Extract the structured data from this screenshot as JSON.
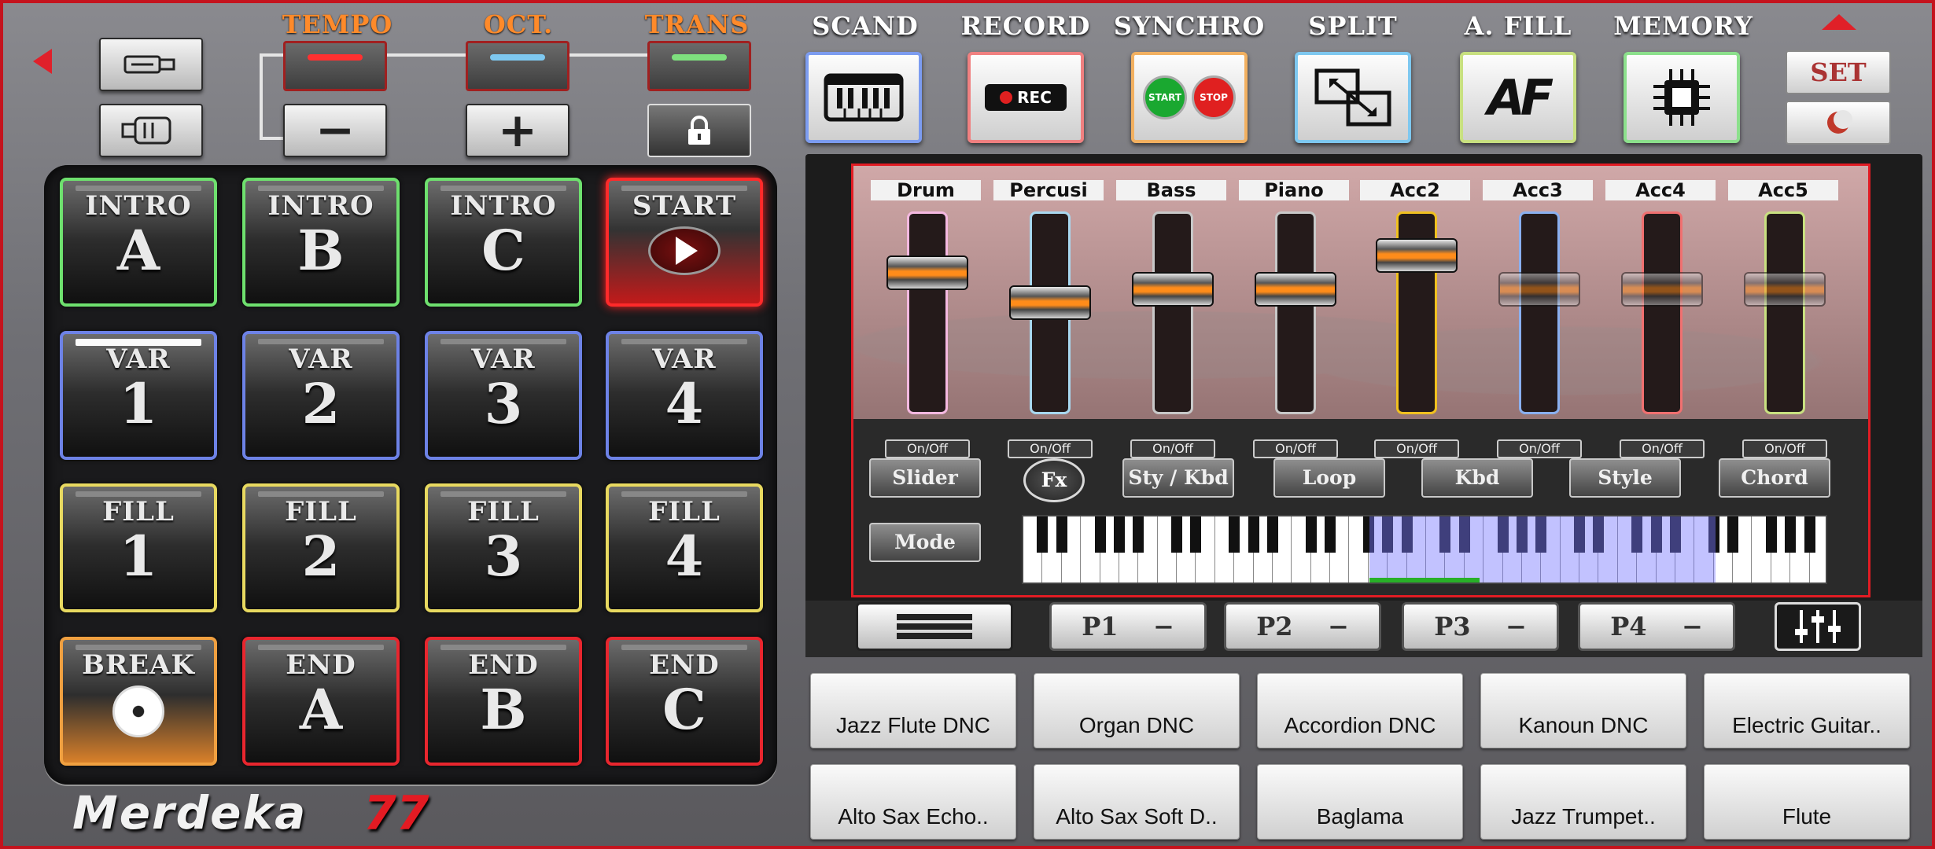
{
  "top_left": {
    "tempo_label": "TEMPO",
    "oct_label": "OCT.",
    "trans_label": "TRANS",
    "minus_label": "−",
    "plus_label": "+",
    "led_colors": {
      "tempo": "#ff3030",
      "oct": "#7ec8f0",
      "trans": "#7ee07e"
    }
  },
  "style_pads": [
    {
      "top": "INTRO",
      "big": "A",
      "group": "green"
    },
    {
      "top": "INTRO",
      "big": "B",
      "group": "green"
    },
    {
      "top": "INTRO",
      "big": "C",
      "group": "green"
    },
    {
      "top": "START",
      "big": "",
      "group": "start",
      "icon": "play-icon"
    },
    {
      "top": "VAR",
      "big": "1",
      "group": "blue",
      "active": true
    },
    {
      "top": "VAR",
      "big": "2",
      "group": "blue"
    },
    {
      "top": "VAR",
      "big": "3",
      "group": "blue"
    },
    {
      "top": "VAR",
      "big": "4",
      "group": "blue"
    },
    {
      "top": "FILL",
      "big": "1",
      "group": "yellow"
    },
    {
      "top": "FILL",
      "big": "2",
      "group": "yellow"
    },
    {
      "top": "FILL",
      "big": "3",
      "group": "yellow"
    },
    {
      "top": "FILL",
      "big": "4",
      "group": "yellow"
    },
    {
      "top": "BREAK",
      "big": "",
      "group": "break",
      "icon": "break-disc-icon"
    },
    {
      "top": "END",
      "big": "A",
      "group": "red"
    },
    {
      "top": "END",
      "big": "B",
      "group": "red"
    },
    {
      "top": "END",
      "big": "C",
      "group": "red"
    }
  ],
  "brand": {
    "name": "Merdeka",
    "number": "77"
  },
  "features": {
    "scand": "SCAND",
    "record": "RECORD",
    "record_button": "REC",
    "synchro": "SYNCHRO",
    "synchro_start": "START",
    "synchro_stop": "STOP",
    "split": "SPLIT",
    "afill": "A. FILL",
    "afill_icon_text": "AF",
    "memory": "MEMORY",
    "set": "SET"
  },
  "mixer": {
    "channels": [
      {
        "name": "Drum",
        "level": 0.74,
        "color": "#f4b8e0"
      },
      {
        "name": "Percusi",
        "level": 0.56,
        "color": "#a8d8f0"
      },
      {
        "name": "Bass",
        "level": 0.64,
        "color": "#c8c8c8"
      },
      {
        "name": "Piano",
        "level": 0.64,
        "color": "#c8c8c8"
      },
      {
        "name": "Acc2",
        "level": 0.84,
        "color": "#f0c020"
      },
      {
        "name": "Acc3",
        "level": 0.64,
        "color": "#8ab0f0",
        "dim": true
      },
      {
        "name": "Acc4",
        "level": 0.64,
        "color": "#f07070",
        "dim": true
      },
      {
        "name": "Acc5",
        "level": 0.64,
        "color": "#c8e080",
        "dim": true
      }
    ],
    "onoff_label": "On/Off",
    "buttons": {
      "slider": "Slider",
      "fx": "Fx",
      "sty_kbd": "Sty / Kbd",
      "loop": "Loop",
      "kbd": "Kbd",
      "style": "Style",
      "chord": "Chord",
      "mode": "Mode"
    }
  },
  "parts": [
    {
      "label": "P1",
      "suffix": "−"
    },
    {
      "label": "P2",
      "suffix": "−"
    },
    {
      "label": "P3",
      "suffix": "−"
    },
    {
      "label": "P4",
      "suffix": "−"
    }
  ],
  "voices": [
    "Jazz Flute DNC",
    "Organ DNC",
    "Accordion DNC",
    "Kanoun DNC",
    "Electric Guitar..",
    "Alto Sax Echo..",
    "Alto Sax Soft D..",
    "Baglama",
    "Jazz Trumpet..",
    "Flute"
  ]
}
